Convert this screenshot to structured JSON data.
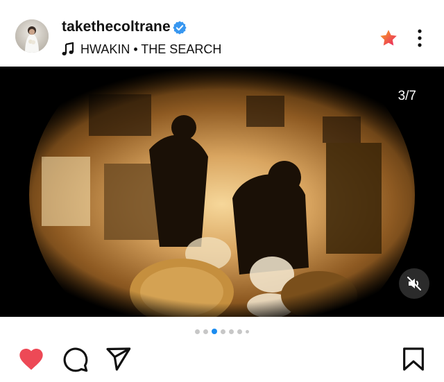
{
  "post": {
    "username": "takethecoltrane",
    "verified": true,
    "music": "HWAKIN • THE SEARCH",
    "carousel_counter": "3/7",
    "carousel_total": 7,
    "carousel_index": 3,
    "liked": true
  },
  "icons": {
    "verified": "verified-badge-icon",
    "music": "music-note-icon",
    "favorite": "star-icon",
    "more": "more-options-icon",
    "mute": "volume-muted-icon",
    "like": "heart-icon",
    "comment": "comment-icon",
    "share": "send-icon",
    "save": "bookmark-icon"
  },
  "colors": {
    "like": "#ED4956",
    "verified": "#3897F0",
    "active_dot": "#1B8CF0",
    "star_from": "#F9A825",
    "star_to": "#E91E63"
  }
}
